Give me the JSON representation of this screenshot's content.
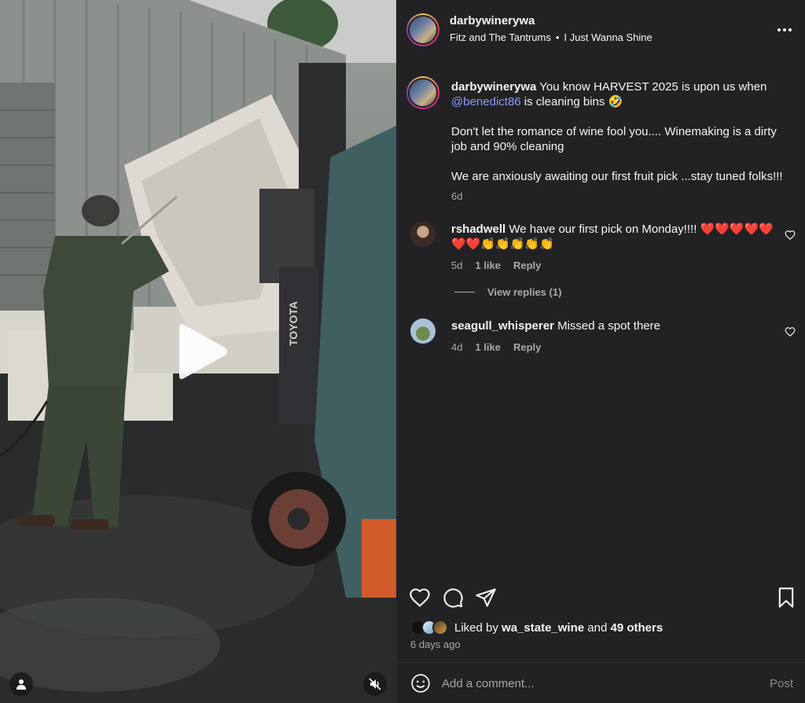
{
  "post": {
    "username": "darbywinerywa",
    "music_artist": "Fitz and The Tantrums",
    "music_separator": "•",
    "music_track": "I Just Wanna Shine",
    "caption": {
      "username": "darbywinerywa",
      "line1_prefix": "You know HARVEST 2025 is upon us when",
      "mention": "@benedict86",
      "line1_suffix": "is cleaning bins 🤣",
      "para2": "Don't let the romance of wine fool you.... Winemaking is a dirty job and 90% cleaning",
      "para3": "We are anxiously awaiting our first fruit pick ...stay tuned folks!!!",
      "time": "6d"
    }
  },
  "comments": [
    {
      "username": "rshadwell",
      "text": "We have our first pick on Monday!!!! ❤️❤️❤️❤️❤️❤️❤️👏👏👏👏👏",
      "time": "5d",
      "likes": "1 like",
      "reply_label": "Reply"
    },
    {
      "username": "seagull_whisperer",
      "text": "Missed a spot there",
      "time": "4d",
      "likes": "1 like",
      "reply_label": "Reply"
    }
  ],
  "view_replies": "View replies (1)",
  "likes_summary": {
    "prefix": "Liked by",
    "user": "wa_state_wine",
    "conjunction": "and",
    "others": "49 others"
  },
  "posted_time": "6 days ago",
  "comment_bar": {
    "placeholder": "Add a comment...",
    "post_label": "Post"
  },
  "media": {
    "forklift_brand": "TOYOTA"
  },
  "icons": {
    "more": "more-options-icon",
    "like": "heart-icon",
    "comment": "comment-icon",
    "share": "send-icon",
    "save": "bookmark-icon",
    "emoji": "emoji-icon",
    "play": "play-icon",
    "tagged_user": "user-tag-icon",
    "mute": "muted-speaker-icon"
  },
  "colors": {
    "panel_bg": "#222225",
    "mention": "#8a9bf7",
    "muted_text": "#a8a8a8"
  }
}
